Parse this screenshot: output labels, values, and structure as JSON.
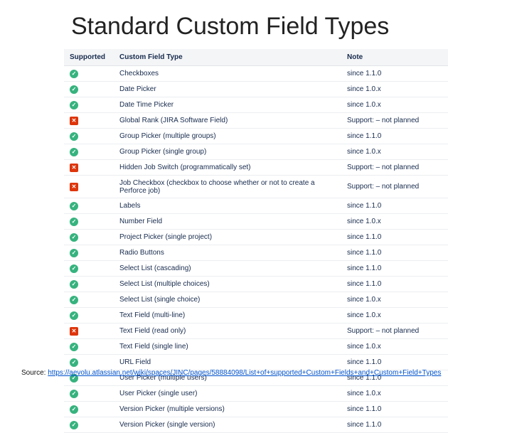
{
  "title": "Standard Custom Field Types",
  "columns": {
    "supported": "Supported",
    "type": "Custom Field Type",
    "note": "Note"
  },
  "rows": [
    {
      "supported": true,
      "type": "Checkboxes",
      "note": "since 1.1.0"
    },
    {
      "supported": true,
      "type": "Date Picker",
      "note": "since 1.0.x"
    },
    {
      "supported": true,
      "type": "Date Time Picker",
      "note": "since 1.0.x"
    },
    {
      "supported": false,
      "type": "Global Rank (JIRA Software Field)",
      "note": "Support: – not planned"
    },
    {
      "supported": true,
      "type": "Group Picker (multiple groups)",
      "note": "since 1.1.0"
    },
    {
      "supported": true,
      "type": "Group Picker (single group)",
      "note": "since 1.0.x"
    },
    {
      "supported": false,
      "type": "Hidden Job Switch (programmatically set)",
      "note": "Support: – not planned"
    },
    {
      "supported": false,
      "type": "Job Checkbox (checkbox to choose whether or not to create a Perforce job)",
      "note": "Support: – not planned"
    },
    {
      "supported": true,
      "type": "Labels",
      "note": "since 1.1.0"
    },
    {
      "supported": true,
      "type": "Number Field",
      "note": "since 1.0.x"
    },
    {
      "supported": true,
      "type": "Project Picker (single project)",
      "note": "since 1.1.0"
    },
    {
      "supported": true,
      "type": "Radio Buttons",
      "note": "since 1.1.0"
    },
    {
      "supported": true,
      "type": "Select List (cascading)",
      "note": "since 1.1.0"
    },
    {
      "supported": true,
      "type": "Select List (multiple choices)",
      "note": "since 1.1.0"
    },
    {
      "supported": true,
      "type": "Select List (single choice)",
      "note": "since 1.0.x"
    },
    {
      "supported": true,
      "type": "Text Field (multi-line)",
      "note": "since 1.0.x"
    },
    {
      "supported": false,
      "type": "Text Field (read only)",
      "note": "Support: – not planned"
    },
    {
      "supported": true,
      "type": "Text Field (single line)",
      "note": "since 1.0.x"
    },
    {
      "supported": true,
      "type": "URL Field",
      "note": "since 1.1.0"
    },
    {
      "supported": true,
      "type": "User Picker (multiple users)",
      "note": "since 1.1.0"
    },
    {
      "supported": true,
      "type": "User Picker (single user)",
      "note": "since 1.0.x"
    },
    {
      "supported": true,
      "type": "Version Picker (multiple versions)",
      "note": "since 1.1.0"
    },
    {
      "supported": true,
      "type": "Version Picker (single version)",
      "note": "since 1.1.0"
    }
  ],
  "source": {
    "label": "Source: ",
    "url_text": "https://aevolu.atlassian.net/wiki/spaces/JINC/pages/58884098/List+of+supported+Custom+Fields+and+Custom+Field+Types"
  }
}
